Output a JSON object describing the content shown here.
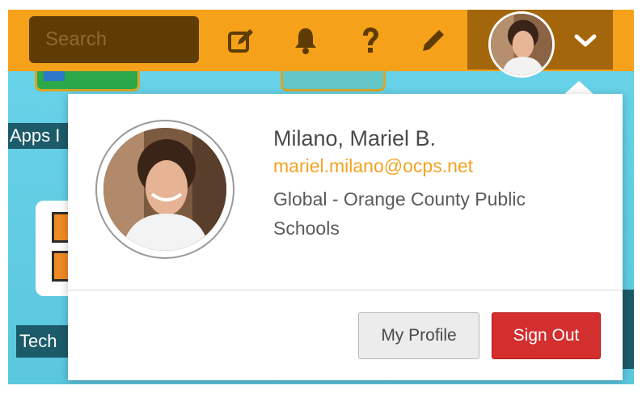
{
  "search": {
    "placeholder": "Search"
  },
  "toolbar": {
    "icons": [
      "edit-icon",
      "bell-icon",
      "help-icon",
      "pencil-icon"
    ],
    "accent": "#f5a11a"
  },
  "background": {
    "apps_label": "Apps I",
    "tech_label": "Tech"
  },
  "profile": {
    "name": "Milano, Mariel B.",
    "email": "mariel.milano@ocps.net",
    "organization": "Global - Orange County Public Schools"
  },
  "actions": {
    "my_profile_label": "My Profile",
    "sign_out_label": "Sign Out",
    "sign_out_color": "#d32f2f"
  }
}
